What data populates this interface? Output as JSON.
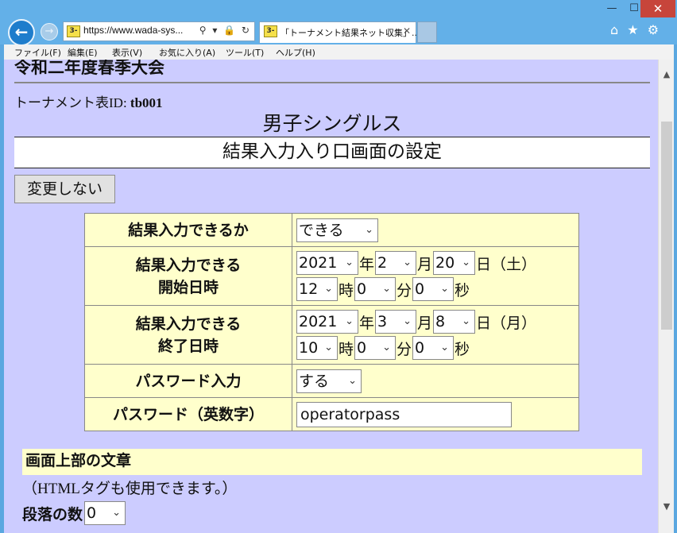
{
  "window": {
    "minimize_glyph": "—",
    "maximize_glyph": "☐",
    "close_glyph": "✕"
  },
  "browser": {
    "url": "https://www.wada-sys...",
    "address_icons": "⚲ ▾ 🔒 ↻",
    "favicon_glyph": "3-",
    "tab_title": "「トーナメント結果ネット収集」...",
    "tab_close": "✕",
    "toolbar_icons": {
      "home": "⌂",
      "favorites": "★",
      "settings": "⚙"
    }
  },
  "menu": [
    "ファイル(F)",
    "編集(E)",
    "表示(V)",
    "お気に入り(A)",
    "ツール(T)",
    "ヘルプ(H)"
  ],
  "page": {
    "event_title": "令和二年度春季大会",
    "tournament_id_label": "トーナメント表ID: ",
    "tournament_id": "tb001",
    "category": "男子シングルス",
    "section_title": "結果入力入り口画面の設定",
    "no_change_button": "変更しない"
  },
  "settings": {
    "can_input": {
      "label": "結果入力できるか",
      "value": "できる"
    },
    "start": {
      "label_line1": "結果入力できる",
      "label_line2": "開始日時",
      "year": "2021",
      "month": "2",
      "day": "20",
      "weekday": "日（土）",
      "hour": "12",
      "minute": "0",
      "second": "0"
    },
    "end": {
      "label_line1": "結果入力できる",
      "label_line2": "終了日時",
      "year": "2021",
      "month": "3",
      "day": "8",
      "weekday": "日（月）",
      "hour": "10",
      "minute": "0",
      "second": "0"
    },
    "password_input": {
      "label": "パスワード入力",
      "value": "する"
    },
    "password": {
      "label": "パスワード（英数字）",
      "value": "operatorpass"
    },
    "units": {
      "year": "年",
      "month": "月",
      "hour": "時",
      "minute": "分",
      "second": "秒"
    }
  },
  "paragraph": {
    "heading": "画面上部の文章",
    "note": "（HTMLタグも使用できます。）",
    "count_label": "段落の数",
    "count_value": "0"
  }
}
